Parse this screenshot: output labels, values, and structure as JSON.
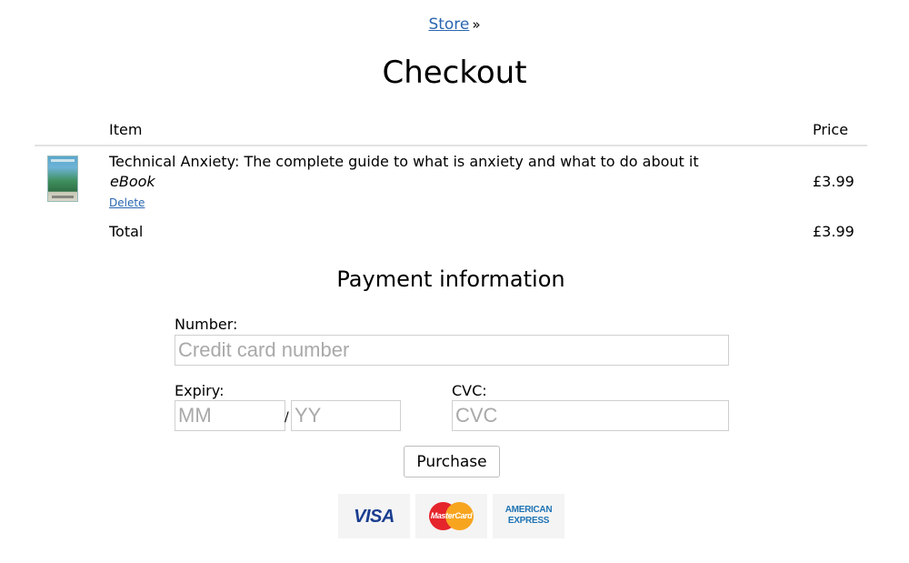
{
  "breadcrumb": {
    "link": "Store",
    "separator": "»"
  },
  "page_title": "Checkout",
  "table": {
    "headers": {
      "item": "Item",
      "price": "Price"
    },
    "items": [
      {
        "title": "Technical Anxiety: The complete guide to what is anxiety and what to do about it",
        "format": "eBook",
        "delete_label": "Delete",
        "price": "£3.99",
        "thumbnail": "book-cover"
      }
    ],
    "total": {
      "label": "Total",
      "price": "£3.99"
    }
  },
  "payment": {
    "title": "Payment information",
    "number": {
      "label": "Number:",
      "value": "",
      "placeholder": "Credit card number"
    },
    "expiry": {
      "label": "Expiry:",
      "month": {
        "value": "",
        "placeholder": "MM"
      },
      "separator": "/",
      "year": {
        "value": "",
        "placeholder": "YY"
      }
    },
    "cvc": {
      "label": "CVC:",
      "value": "",
      "placeholder": "CVC"
    },
    "purchase_label": "Purchase"
  },
  "cards": {
    "visa": "VISA",
    "mastercard": "MasterCard",
    "amex_line1": "AMERICAN",
    "amex_line2": "EXPRESS"
  },
  "colors": {
    "link": "#2a66b0",
    "visa": "#1a3d8f",
    "mastercard_red": "#e5242b",
    "mastercard_yellow": "#f7a51f",
    "amex": "#1e74b4"
  }
}
